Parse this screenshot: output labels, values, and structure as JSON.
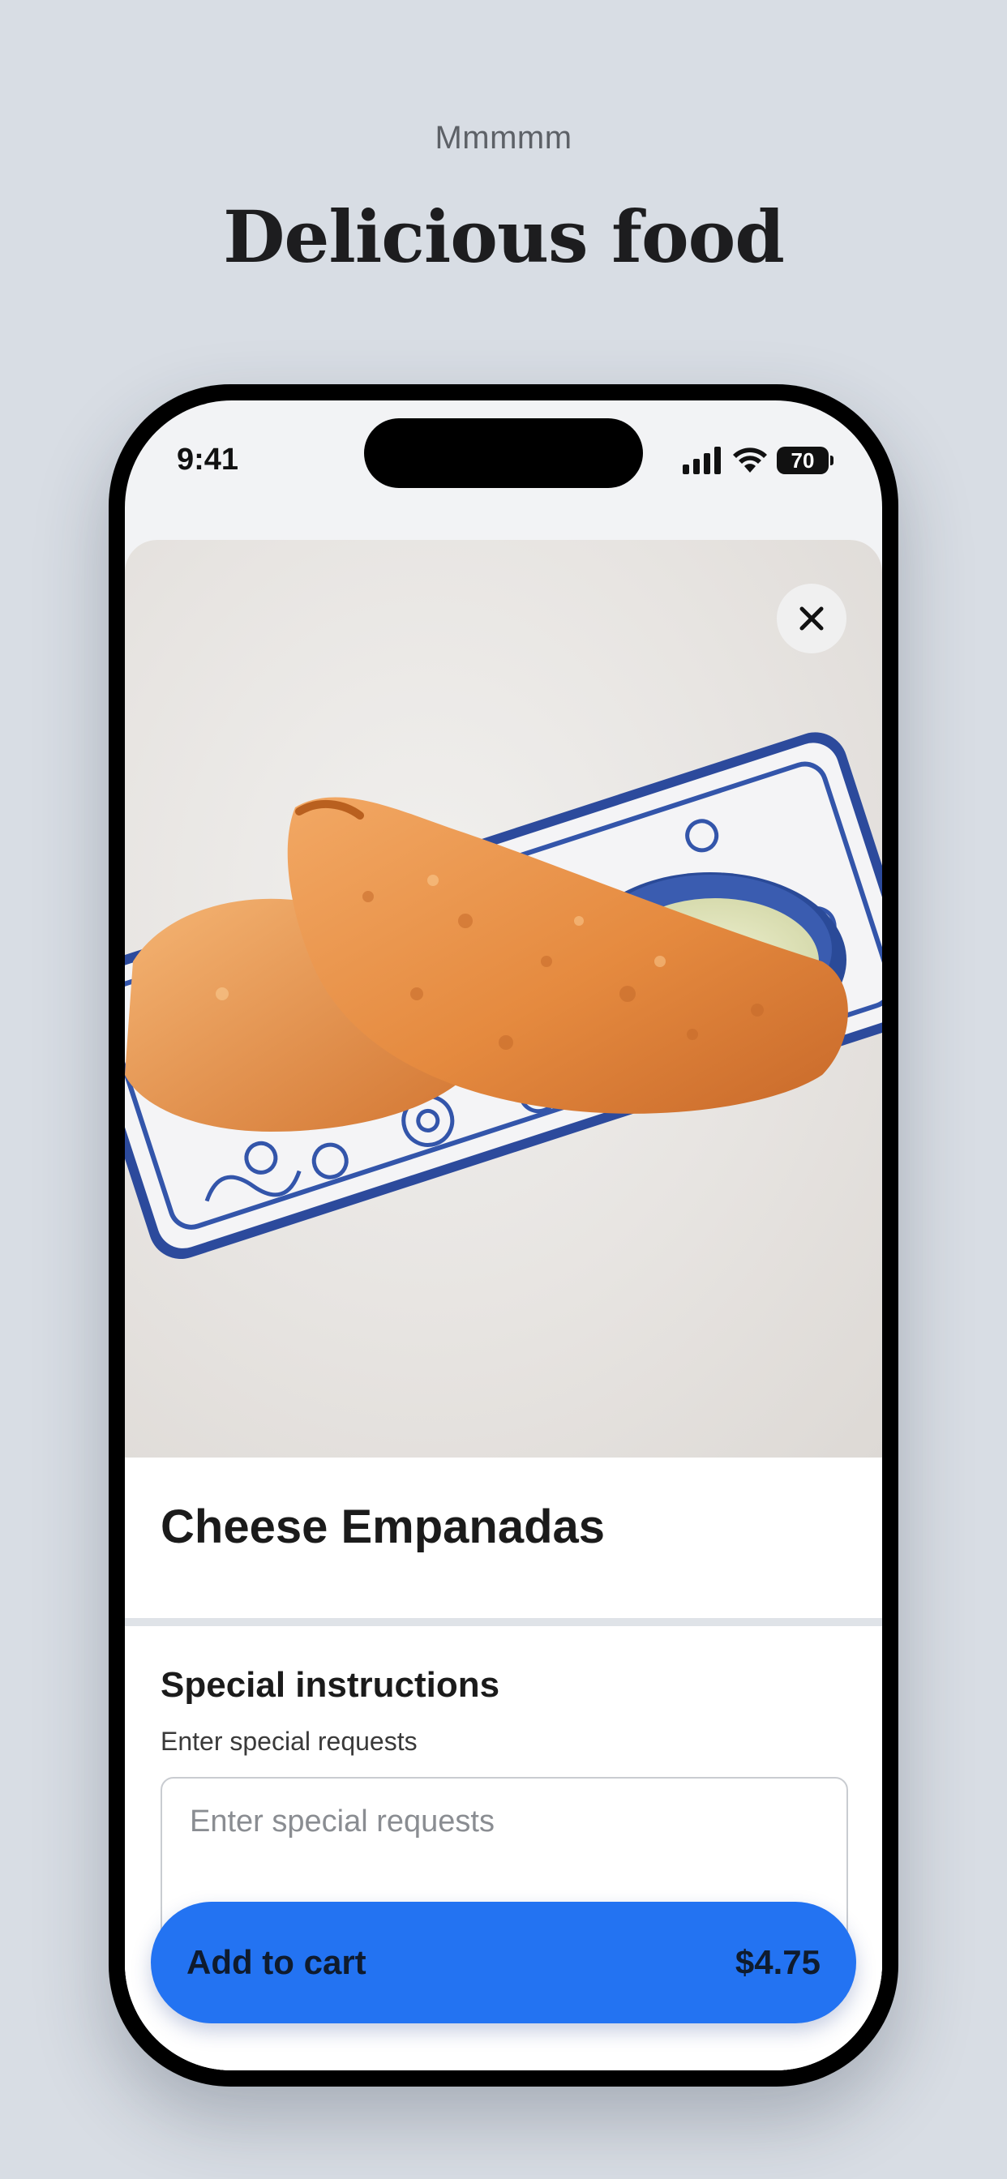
{
  "header": {
    "eyebrow": "Mmmmm",
    "title": "Delicious food"
  },
  "status_bar": {
    "time": "9:41",
    "battery": "70"
  },
  "item": {
    "name": "Cheese Empanadas",
    "image_icon": "food-photo"
  },
  "instructions": {
    "title": "Special instructions",
    "label": "Enter special requests",
    "placeholder": "Enter special requests"
  },
  "cart_button": {
    "label": "Add to cart",
    "price": "$4.75"
  },
  "colors": {
    "background": "#d8dde4",
    "accent": "#2373f2"
  }
}
